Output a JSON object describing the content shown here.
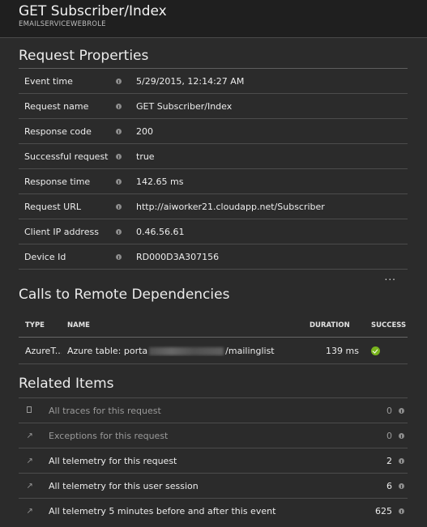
{
  "header": {
    "title": "GET Subscriber/Index",
    "subtitle": "EMAILSERVICEWEBROLE"
  },
  "request_properties": {
    "title": "Request Properties",
    "rows": [
      {
        "label": "Event time",
        "value": "5/29/2015, 12:14:27 AM"
      },
      {
        "label": "Request name",
        "value": "GET Subscriber/Index"
      },
      {
        "label": "Response code",
        "value": "200"
      },
      {
        "label": "Successful request",
        "value": "true"
      },
      {
        "label": "Response time",
        "value": "142.65 ms"
      },
      {
        "label": "Request URL",
        "value": "http://aiworker21.cloudapp.net/Subscriber"
      },
      {
        "label": "Client IP address",
        "value": "0.46.56.61"
      },
      {
        "label": "Device Id",
        "value": "RD000D3A307156"
      }
    ],
    "more_label": "..."
  },
  "dependencies": {
    "title": "Calls to Remote Dependencies",
    "columns": {
      "type": "TYPE",
      "name": "NAME",
      "duration": "DURATION",
      "success": "SUCCESS"
    },
    "rows": [
      {
        "type": "AzureT...",
        "name_prefix": "Azure table: porta",
        "name_suffix": "/mailinglist",
        "duration": "139 ms",
        "success_icon": "check-circle-icon"
      }
    ]
  },
  "related": {
    "title": "Related Items",
    "items": [
      {
        "icon": "document-icon",
        "label": "All traces for this request",
        "count": "0",
        "dim": true
      },
      {
        "icon": "arrow-icon",
        "label": "Exceptions for this request",
        "count": "0",
        "dim": true
      },
      {
        "icon": "arrow-icon",
        "label": "All telemetry for this request",
        "count": "2",
        "dim": false
      },
      {
        "icon": "arrow-icon",
        "label": "All telemetry for this user session",
        "count": "6",
        "dim": false
      },
      {
        "icon": "arrow-icon",
        "label": "All telemetry 5 minutes before and after this event",
        "count": "625",
        "dim": false
      }
    ]
  },
  "colors": {
    "background": "#2b2b2b",
    "header_background": "#1f1f1f",
    "success_green": "#7ab51d"
  }
}
